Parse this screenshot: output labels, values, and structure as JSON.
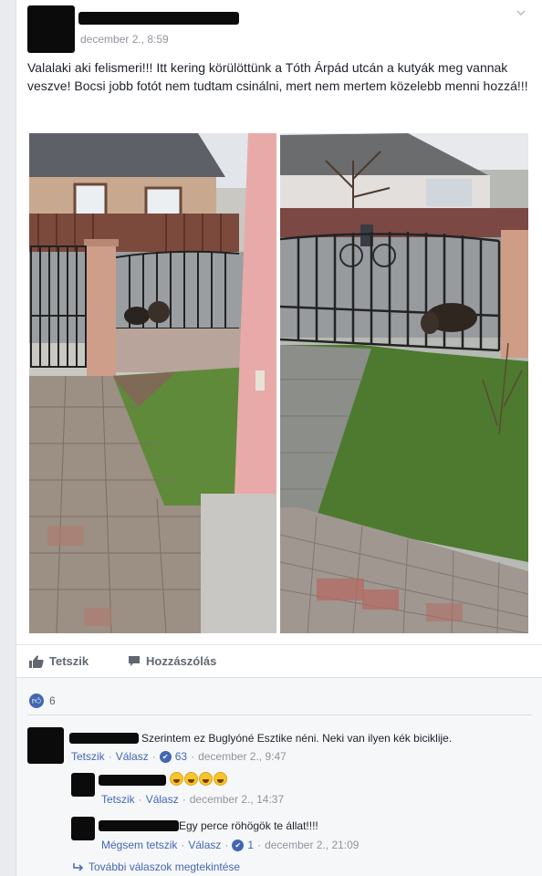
{
  "post": {
    "timestamp": "december 2., 8:59",
    "text": "Valalaki aki felismeri!!! Itt kering körülöttünk a Tóth Árpád utcán a kutyák meg vannak veszve! Bocsi jobb fotót nem tudtam csinálni, mert nem mertem közelebb menni hozzá!!!",
    "menu_icon": "chevron-down-icon"
  },
  "actions": {
    "like_label": "Tetszik",
    "comment_label": "Hozzászólás"
  },
  "reactions": {
    "count": "6"
  },
  "comments": [
    {
      "text": "Szerintem ez Buglyóné Esztike néni. Neki van ilyen kék biciklije.",
      "like_link": "Tetszik",
      "reply_link": "Válasz",
      "likes": "63",
      "time": "december 2., 9:47"
    }
  ],
  "replies": [
    {
      "text": "",
      "like_link": "Tetszik",
      "reply_link": "Válasz",
      "time": "december 2., 14:37"
    },
    {
      "text": "Egy perce röhögök te állat!!!!",
      "like_link": "Mégsem tetszik",
      "reply_link": "Válasz",
      "likes": "1",
      "time": "december 2., 21:09"
    }
  ],
  "more_replies_label": "További válaszok megtekintése",
  "colors": {
    "link": "#4267b2",
    "meta": "#90949c",
    "background": "#e9ebee",
    "comments_bg": "#f6f7f9"
  }
}
